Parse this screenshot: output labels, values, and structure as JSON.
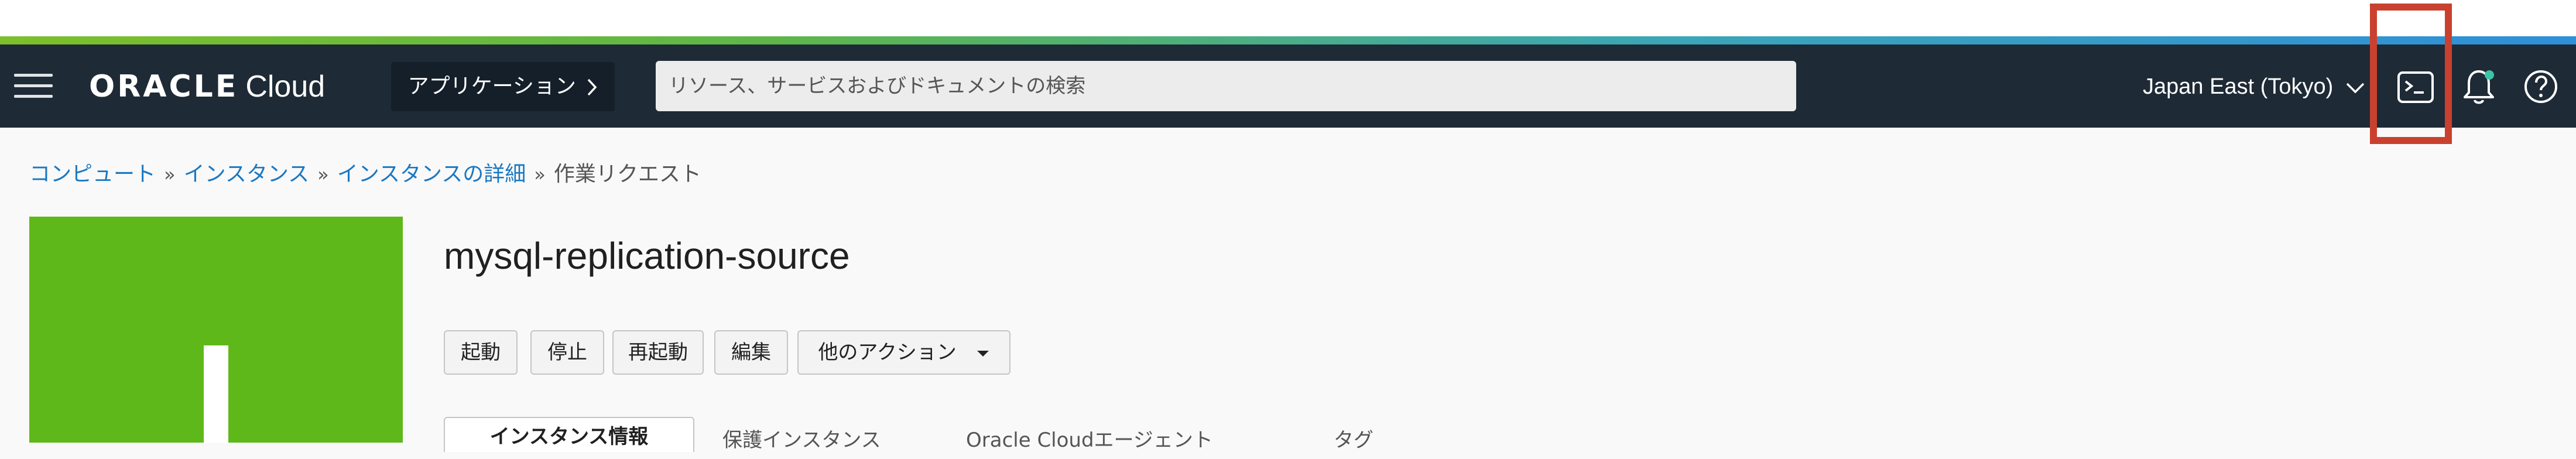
{
  "navbar": {
    "logo_oracle": "ORACLE",
    "logo_cloud": "Cloud",
    "apps_button": "アプリケーション",
    "search_placeholder": "リソース、サービスおよびドキュメントの検索",
    "region": "Japan East (Tokyo)",
    "icons": [
      "menu-icon",
      "chevron-right-icon",
      "chevron-down-icon",
      "cloud-shell-icon",
      "bell-icon",
      "help-icon"
    ],
    "notification_dot_color": "#3ec2a8"
  },
  "breadcrumb": {
    "items": [
      "コンピュート",
      "インスタンス",
      "インスタンスの詳細"
    ],
    "current": "作業リクエスト",
    "separator": "»"
  },
  "instance": {
    "name": "mysql-replication-source",
    "icon_color": "#5fb81a"
  },
  "actions": {
    "start": "起動",
    "stop": "停止",
    "restart": "再起動",
    "edit": "編集",
    "more": "他のアクション"
  },
  "tabs": [
    "インスタンス情報",
    "保護インスタンス",
    "Oracle Cloudエージェント",
    "タグ"
  ],
  "colors": {
    "navbar_bg": "#1e2a36",
    "link": "#1a78c2",
    "highlight": "#c9412e"
  }
}
